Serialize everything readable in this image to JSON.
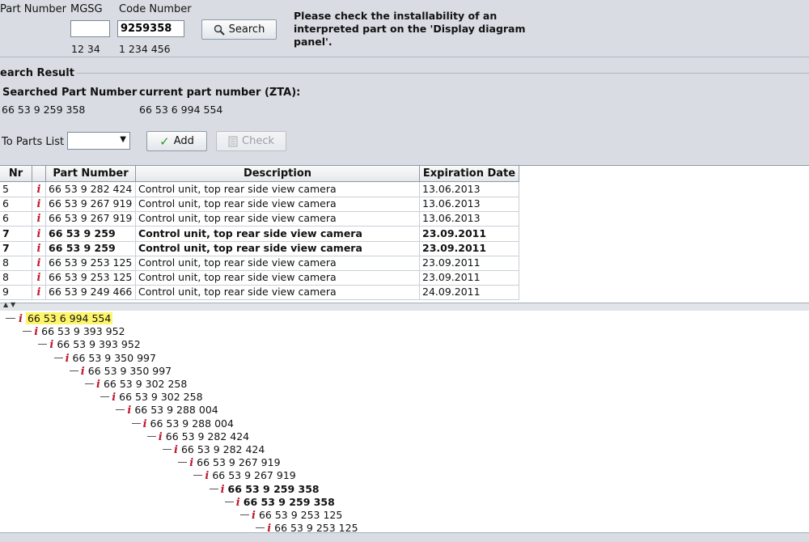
{
  "search": {
    "part_number_label": "Part Number",
    "mgsg_label": "MGSG",
    "code_number_label": "Code Number",
    "mgsg_value": "",
    "code_number_value": "9259358",
    "mgsg_hint": "12 34",
    "code_hint": "1 234 456",
    "search_button": "Search",
    "notice": "Please check the installability of an interpreted part on the 'Display diagram panel'."
  },
  "result": {
    "section_title": "earch Result",
    "searched_label": "Searched Part Number",
    "searched_value": "66 53 9 259 358",
    "current_label": "current part number (ZTA):",
    "current_value": "66 53 6 994 554"
  },
  "parts_list": {
    "label": "To Parts List",
    "selected": "",
    "add_button": "Add",
    "check_button": "Check"
  },
  "table": {
    "headers": {
      "nr": "Nr",
      "info": "",
      "part": "Part Number",
      "desc": "Description",
      "exp": "Expiration Date"
    },
    "rows": [
      {
        "nr": "5",
        "part": "66 53 9 282 424",
        "desc": "Control unit, top rear side view camera",
        "exp": "13.06.2013",
        "bold": false
      },
      {
        "nr": "6",
        "part": "66 53 9 267 919",
        "desc": "Control unit, top rear side view camera",
        "exp": "13.06.2013",
        "bold": false
      },
      {
        "nr": "6",
        "part": "66 53 9 267 919",
        "desc": "Control unit, top rear side view camera",
        "exp": "13.06.2013",
        "bold": false
      },
      {
        "nr": "7",
        "part": "66 53 9 259 358",
        "desc": "Control unit, top rear side view camera",
        "exp": "23.09.2011",
        "bold": true
      },
      {
        "nr": "7",
        "part": "66 53 9 259 358",
        "desc": "Control unit, top rear side view camera",
        "exp": "23.09.2011",
        "bold": true
      },
      {
        "nr": "8",
        "part": "66 53 9 253 125",
        "desc": "Control unit, top rear side view camera",
        "exp": "23.09.2011",
        "bold": false
      },
      {
        "nr": "8",
        "part": "66 53 9 253 125",
        "desc": "Control unit, top rear side view camera",
        "exp": "23.09.2011",
        "bold": false
      },
      {
        "nr": "9",
        "part": "66 53 9 249 466",
        "desc": "Control unit, top rear side view camera",
        "exp": "24.09.2011",
        "bold": false
      }
    ]
  },
  "tree": {
    "nodes": [
      {
        "label": "66 53 6 994 554",
        "highlight": true,
        "bold": false
      },
      {
        "label": "66 53 9 393 952",
        "highlight": false,
        "bold": false
      },
      {
        "label": "66 53 9 393 952",
        "highlight": false,
        "bold": false
      },
      {
        "label": "66 53 9 350 997",
        "highlight": false,
        "bold": false
      },
      {
        "label": "66 53 9 350 997",
        "highlight": false,
        "bold": false
      },
      {
        "label": "66 53 9 302 258",
        "highlight": false,
        "bold": false
      },
      {
        "label": "66 53 9 302 258",
        "highlight": false,
        "bold": false
      },
      {
        "label": "66 53 9 288 004",
        "highlight": false,
        "bold": false
      },
      {
        "label": "66 53 9 288 004",
        "highlight": false,
        "bold": false
      },
      {
        "label": "66 53 9 282 424",
        "highlight": false,
        "bold": false
      },
      {
        "label": "66 53 9 282 424",
        "highlight": false,
        "bold": false
      },
      {
        "label": "66 53 9 267 919",
        "highlight": false,
        "bold": false
      },
      {
        "label": "66 53 9 267 919",
        "highlight": false,
        "bold": false
      },
      {
        "label": "66 53 9 259 358",
        "highlight": false,
        "bold": true
      },
      {
        "label": "66 53 9 259 358",
        "highlight": false,
        "bold": true
      },
      {
        "label": "66 53 9 253 125",
        "highlight": false,
        "bold": false
      },
      {
        "label": "66 53 9 253 125",
        "highlight": false,
        "bold": false
      }
    ]
  },
  "icons": {
    "info": "i",
    "check": "✓",
    "search": "magnifier-icon",
    "dropdown": "▼",
    "expand_up": "▲",
    "expand_down": "▼"
  },
  "colors": {
    "info_red": "#c0182b",
    "highlight_yellow": "#fff56b",
    "check_green": "#2a9a2a"
  }
}
